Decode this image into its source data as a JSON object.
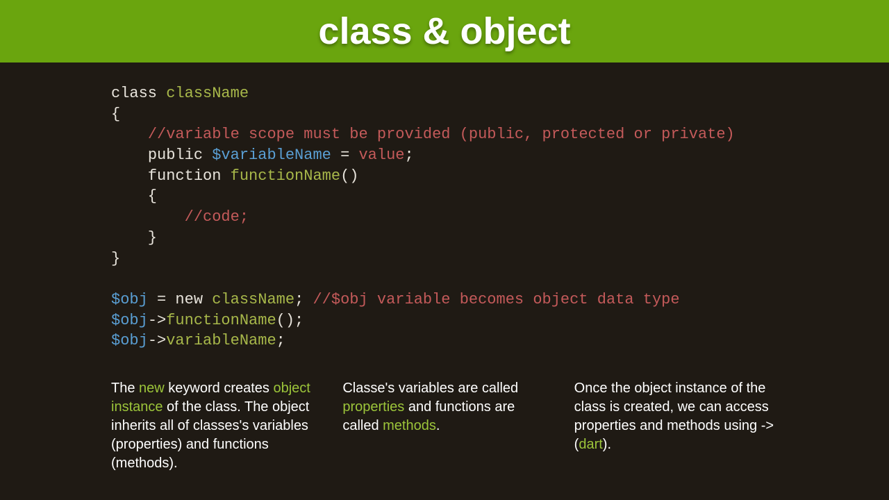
{
  "header": {
    "title": "class & object"
  },
  "code": {
    "l1_kw": "class ",
    "l1_cn": "className",
    "l2": "{",
    "l3_indent": "    ",
    "l3_comment": "//variable scope must be provided (public, protected or private)",
    "l4_indent": "    ",
    "l4_kw": "public ",
    "l4_var": "$variableName",
    "l4_eq": " = ",
    "l4_val": "value",
    "l4_semi": ";",
    "l5_indent": "    ",
    "l5_kw": "function ",
    "l5_fn": "functionName",
    "l5_paren": "()",
    "l6": "    {",
    "l7_indent": "        ",
    "l7_comment": "//code;",
    "l8": "    }",
    "l9": "}",
    "blank": "",
    "l10_var": "$obj",
    "l10_eq": " = ",
    "l10_new": "new ",
    "l10_cn": "className",
    "l10_semi": "; ",
    "l10_comment": "//$obj variable becomes object data type",
    "l11_var": "$obj",
    "l11_arrow": "->",
    "l11_fn": "functionName",
    "l11_tail": "();",
    "l12_var": "$obj",
    "l12_arrow": "->",
    "l12_fn": "variableName",
    "l12_tail": ";"
  },
  "explain": {
    "col1": {
      "p1a": "The ",
      "p1_new": "new",
      "p1b": " keyword creates ",
      "p1_oi": "object instance",
      "p1c": " of the class. The object inherits all of classes's variables (properties) and functions (methods)."
    },
    "col2": {
      "p2a": "Classe's variables are called ",
      "p2_props": "properties",
      "p2b": " and functions are called ",
      "p2_methods": "methods",
      "p2c": "."
    },
    "col3": {
      "p3a": "Once the object instance of the class is created, we can access properties and methods using -> (",
      "p3_dart": "dart",
      "p3b": ")."
    }
  }
}
